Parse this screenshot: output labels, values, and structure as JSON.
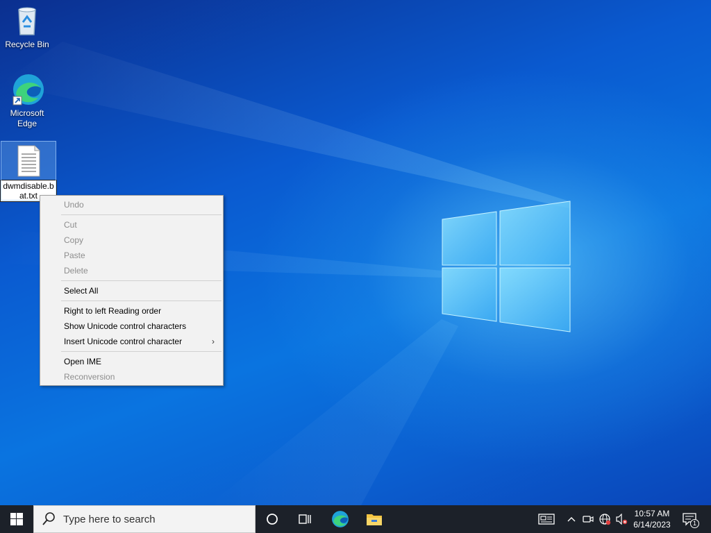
{
  "desktop": {
    "icons": [
      {
        "label": "Recycle Bin",
        "icon": "recycle-bin-icon"
      },
      {
        "label": "Microsoft Edge",
        "icon": "edge-icon"
      },
      {
        "label": "dwmdisable.bat.txt",
        "icon": "text-file-icon",
        "rename_value": "dwmdisable.bat.txt"
      }
    ]
  },
  "context_menu": {
    "undo": "Undo",
    "cut": "Cut",
    "copy": "Copy",
    "paste": "Paste",
    "delete": "Delete",
    "select_all": "Select All",
    "rtl": "Right to left Reading order",
    "show_unicode": "Show Unicode control characters",
    "insert_unicode": "Insert Unicode control character",
    "submenu_arrow": "›",
    "open_ime": "Open IME",
    "reconversion": "Reconversion"
  },
  "taskbar": {
    "search_placeholder": "Type here to search",
    "clock_time": "10:57 AM",
    "clock_date": "6/14/2023",
    "notification_count": "1",
    "icons": [
      "windows-start-icon",
      "search-icon",
      "cortana-icon",
      "task-view-icon",
      "edge-icon",
      "file-explorer-icon",
      "news-icon",
      "chevron-up-icon",
      "meet-now-icon",
      "network-icon",
      "volume-muted-icon",
      "notification-icon"
    ]
  },
  "colors": {
    "taskbar": "#1c2129",
    "menu_bg": "#f2f2f2",
    "disabled_text": "#8d8d8d",
    "desktop_blue": "#0a74e0"
  }
}
